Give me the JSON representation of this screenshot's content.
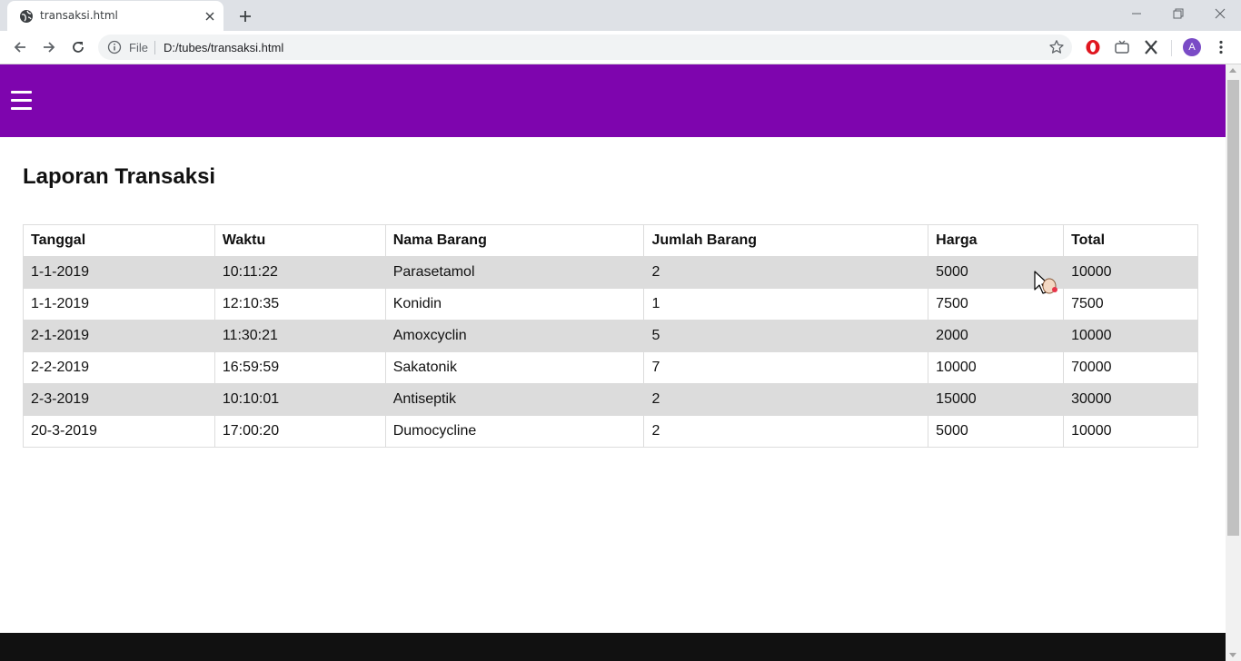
{
  "browser": {
    "tab_title": "transaksi.html",
    "url_scheme": "File",
    "url": "D:/tubes/transaksi.html",
    "profile_initial": "A"
  },
  "colors": {
    "navbar": "#7e05ae",
    "footer": "#111111",
    "row_stripe": "#dcdcdc"
  },
  "navbar": {
    "menu_icon": "hamburger-menu-icon"
  },
  "page": {
    "title": "Laporan Transaksi"
  },
  "table": {
    "headers": [
      "Tanggal",
      "Waktu",
      "Nama Barang",
      "Jumlah Barang",
      "Harga",
      "Total"
    ],
    "rows": [
      [
        "1-1-2019",
        "10:11:22",
        "Parasetamol",
        "2",
        "5000",
        "10000"
      ],
      [
        "1-1-2019",
        "12:10:35",
        "Konidin",
        "1",
        "7500",
        "7500"
      ],
      [
        "2-1-2019",
        "11:30:21",
        "Amoxcyclin",
        "5",
        "2000",
        "10000"
      ],
      [
        "2-2-2019",
        "16:59:59",
        "Sakatonik",
        "7",
        "10000",
        "70000"
      ],
      [
        "2-3-2019",
        "10:10:01",
        "Antiseptik",
        "2",
        "15000",
        "30000"
      ],
      [
        "20-3-2019",
        "17:00:20",
        "Dumocycline",
        "2",
        "5000",
        "10000"
      ]
    ]
  }
}
